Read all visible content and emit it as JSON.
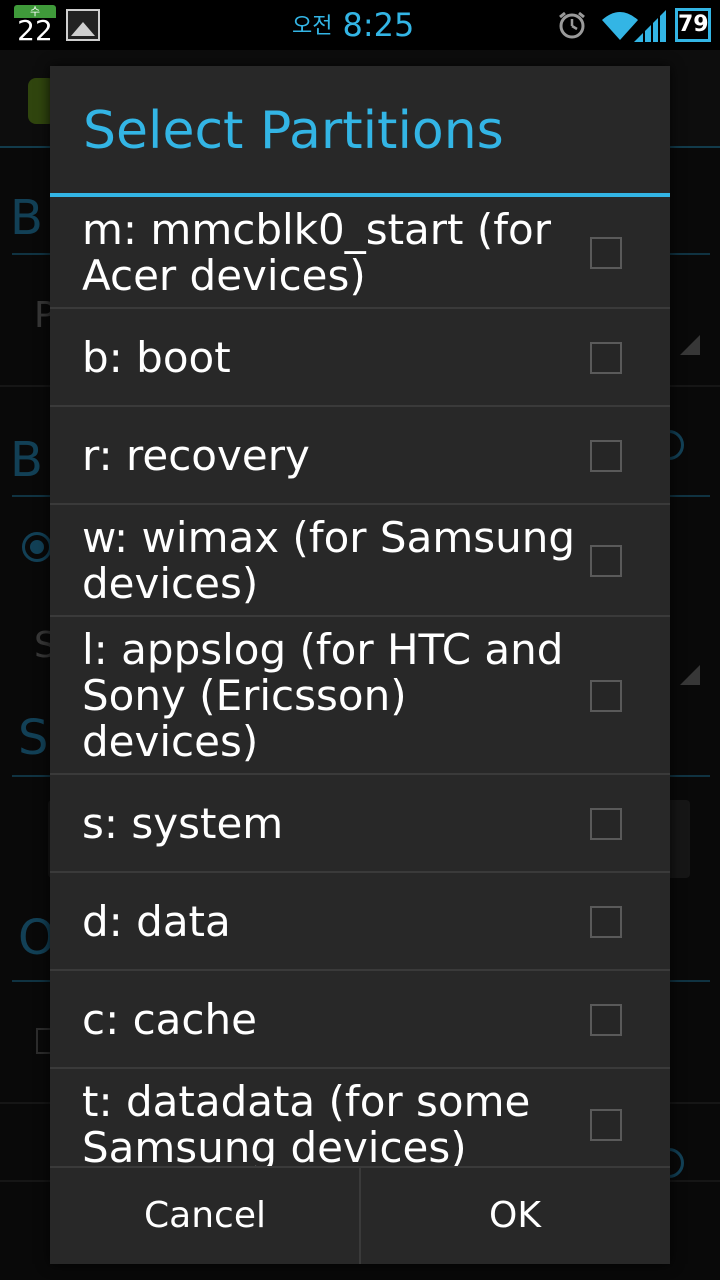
{
  "status_bar": {
    "calendar_day_label": "수",
    "calendar_date": "22",
    "ampm": "오전",
    "time": "8:25",
    "battery_level": "79",
    "icons": [
      "calendar-icon",
      "gallery-icon",
      "alarm-icon",
      "wifi-icon",
      "signal-icon",
      "battery-icon"
    ]
  },
  "dialog": {
    "title": "Select Partitions",
    "accent_color": "#33b5e5",
    "items": [
      {
        "label": "m: mmcblk0_start (for Acer devices)",
        "checked": false
      },
      {
        "label": "b: boot",
        "checked": false
      },
      {
        "label": "r: recovery",
        "checked": false
      },
      {
        "label": "w: wimax (for Samsung devices)",
        "checked": false
      },
      {
        "label": "l: appslog (for HTC and Sony (Ericsson) devices)",
        "checked": false
      },
      {
        "label": "s: system",
        "checked": false
      },
      {
        "label": "d: data",
        "checked": false
      },
      {
        "label": "c: cache",
        "checked": false
      },
      {
        "label": "t: datadata (for some Samsung devices)",
        "checked": false
      }
    ],
    "cancel_label": "Cancel",
    "ok_label": "OK"
  }
}
